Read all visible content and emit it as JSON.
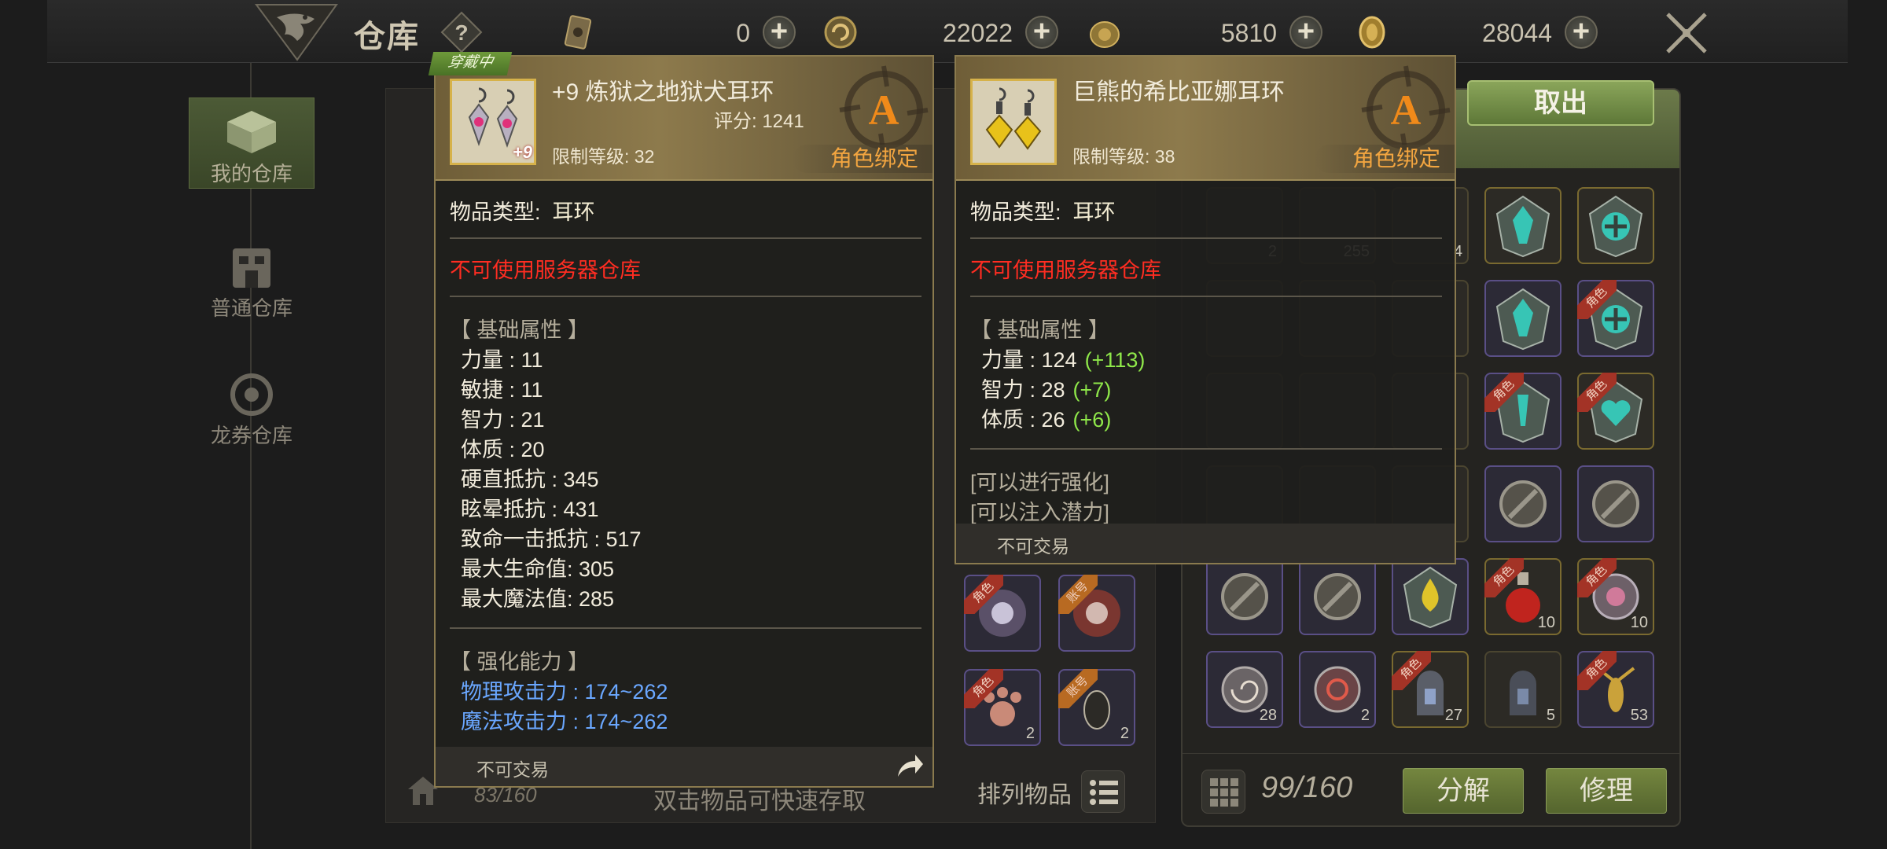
{
  "header": {
    "title": "仓库",
    "currencies": [
      {
        "icon": "ticket-icon",
        "value": "0"
      },
      {
        "icon": "swirl-coin-icon",
        "value": "22022"
      },
      {
        "icon": "gold-bag-icon",
        "value": "5810"
      },
      {
        "icon": "gold-coin-icon",
        "value": "28044"
      }
    ]
  },
  "sidebar": {
    "items": [
      {
        "label": "我的仓库",
        "icon": "box-icon",
        "active": true
      },
      {
        "label": "普通仓库",
        "icon": "building-icon",
        "active": false
      },
      {
        "label": "龙券仓库",
        "icon": "dragon-coin-icon",
        "active": false
      }
    ]
  },
  "storage": {
    "count": "83/160",
    "hint": "双击物品可快速存取",
    "sort_label": "排列物品"
  },
  "inventory": {
    "take_label": "取出",
    "count": "99/160",
    "decompose_label": "分解",
    "repair_label": "修理",
    "slot_counts": [
      "2",
      "255",
      "4",
      "10",
      "10",
      "28",
      "2",
      "27",
      "5",
      "53"
    ],
    "tag_char": "角色",
    "acct_tag_char": "账号"
  },
  "tooltip_left": {
    "equipped_tag": "穿戴中",
    "name": "+9 炼狱之地狱犬耳环",
    "score": "评分: 1241",
    "level": "限制等级: 32",
    "grade": "A",
    "bind": "角色绑定",
    "enhance_badge": "+9",
    "item_type_label": "物品类型:",
    "item_type_value": "耳环",
    "server_warning": "不可使用服务器仓库",
    "base_header": "【 基础属性 】",
    "base_stats": [
      "力量 : 11",
      "敏捷 : 11",
      "智力 : 21",
      "体质 : 20",
      "硬直抵抗 : 345",
      "眩晕抵抗 : 431",
      "致命一击抵抗 : 517",
      "最大生命值:  305",
      "最大魔法值:  285"
    ],
    "enhance_header": "【 强化能力 】",
    "enhance_stats": [
      "物理攻击力 : 174~262",
      "魔法攻击力 : 174~262"
    ],
    "trade": "不可交易"
  },
  "tooltip_right": {
    "name": "巨熊的希比亚娜耳环",
    "level": "限制等级: 38",
    "grade": "A",
    "bind": "角色绑定",
    "item_type_label": "物品类型:",
    "item_type_value": "耳环",
    "server_warning": "不可使用服务器仓库",
    "base_header": "【 基础属性 】",
    "base_stats": [
      {
        "label": "力量 : 124",
        "bonus": "(+113)"
      },
      {
        "label": "智力 : 28",
        "bonus": "(+7)"
      },
      {
        "label": "体质 : 26",
        "bonus": "(+6)"
      }
    ],
    "note_1": "[可以进行强化]",
    "note_2": "[可以注入潜力]",
    "trade": "不可交易"
  },
  "colors": {
    "red_warning": "#ff2d22",
    "blue_stat": "#6aa7ff",
    "green_bonus": "#8fe84a",
    "bind_orange": "#f2a540",
    "button_green": "#74863f"
  }
}
